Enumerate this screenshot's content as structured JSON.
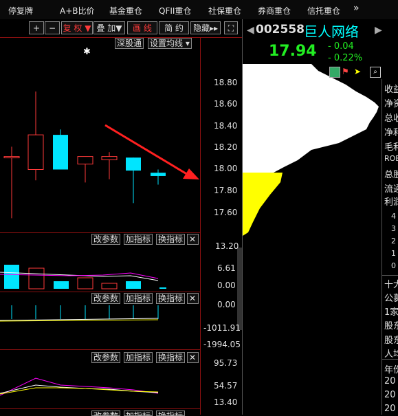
{
  "top_tabs": [
    "停复牌",
    "A+B比价",
    "基金重仓",
    "QFII重仓",
    "社保重仓",
    "券商重仓",
    "信托重仓",
    "»"
  ],
  "toolbar": {
    "plus": "+",
    "minus": "−",
    "fq": "复 权 ▼",
    "overlay": "叠 加▼",
    "draw": "画 线",
    "simple": "简 约",
    "hide": "隐藏▸▸",
    "expand": "⛶"
  },
  "main_chart": {
    "connect_tag": "深股通",
    "ma_setting": "设置均线 ▾",
    "price_ticks": [
      "18.80",
      "18.60",
      "18.40",
      "18.20",
      "18.00",
      "17.80",
      "17.60"
    ],
    "candles": [
      {
        "o": 18.12,
        "h": 18.21,
        "l": 17.55,
        "c": 18.12
      },
      {
        "o": 18.0,
        "h": 18.72,
        "l": 17.9,
        "c": 18.32
      },
      {
        "o": 18.32,
        "h": 18.37,
        "l": 18.0,
        "c": 18.0
      },
      {
        "o": 18.05,
        "h": 18.12,
        "l": 17.88,
        "c": 18.12
      },
      {
        "o": 18.09,
        "h": 18.16,
        "l": 17.91,
        "c": 18.12
      },
      {
        "o": 18.11,
        "h": 18.11,
        "l": 17.69,
        "c": 17.99
      },
      {
        "o": 17.97,
        "h": 18.0,
        "l": 17.86,
        "c": 17.94
      }
    ]
  },
  "ind_buttons": {
    "params": "改参数",
    "add": "加指标",
    "switch": "换指标",
    "close": "✕"
  },
  "volume_panel": {
    "ticks": [
      "13.20",
      "6.61",
      "0.00"
    ]
  },
  "macd_panel": {
    "ticks": [
      "0.00",
      "-1011.91",
      "-1994.05"
    ]
  },
  "kdj_panel": {
    "ticks": [
      "95.73",
      "54.57",
      "13.40"
    ]
  },
  "quote": {
    "code": "002558",
    "name": "巨人网络",
    "price": "17.94",
    "change": "- 0.04",
    "change_pct": "- 0.22%"
  },
  "side_labels": [
    "收益",
    "净资",
    "总收",
    "净利",
    "毛利",
    "ROE",
    "总股",
    "流通",
    "利润",
    "4",
    "3",
    "2",
    "1",
    "0",
    "十大",
    "公募",
    "1家",
    "股东",
    "股东",
    "人均",
    "年份",
    "20",
    "20",
    "20"
  ],
  "colors": {
    "up": "#ff3a3a",
    "down": "#00e5ff",
    "bg": "#000000",
    "accent": "#ffff00"
  }
}
